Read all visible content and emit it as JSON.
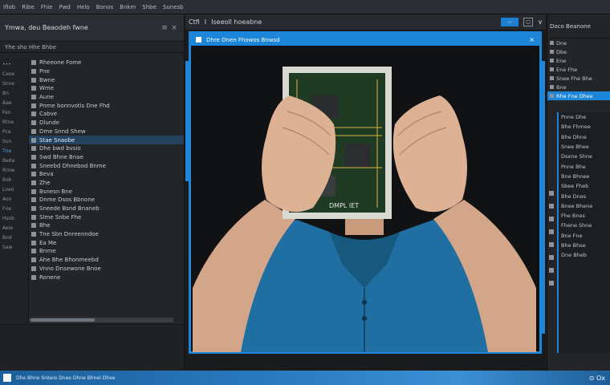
{
  "menubar": [
    "Ifiob",
    "Ribe",
    "Fhie",
    "Pwd",
    "Helo",
    "Bonos",
    "Bnkm",
    "Shbe",
    "Sunesb"
  ],
  "left_panel": {
    "title": "Ymwa, deu Beaodeh fwne",
    "subtitle": "Yhe sho Hhe Bhbe",
    "strip": [
      "•••",
      "Ceoe",
      "Snne",
      "Bn",
      "Aae",
      "Fen",
      "Rtne",
      "Pca",
      "Sun",
      "Tne",
      "Beda",
      "Rrnw",
      "Boh",
      "Lneo",
      "Aon",
      "Fne",
      "Hsob",
      "Aeie",
      "Bnd",
      "Saw"
    ],
    "rows": [
      "Rheeone Fome",
      "Pne",
      "Bwne",
      "Wme",
      "Aune",
      "Pnme bonnvotis Dne Fhd",
      "Cabve",
      "Dlunde",
      "Dme Snnd Shew",
      "Stae Snaobe",
      "Dhe bwd bvsio",
      "Swd Bhne Bnae",
      "Sneebd Dhnebod Bnme",
      "Beva",
      "Zhe",
      "Bsnesn Bne",
      "Dnme Dsos Bbnone",
      "Sneede Bsnd Bnaneb",
      "Slme Snbe Fhe",
      "Bhe",
      "Tne Sbn Dnreenndoe",
      "Ea Me",
      "Bnrne",
      "Ahe Bhe Bhonmeebd",
      "Vnno Dnsewone Bnoe",
      "Ronene"
    ],
    "selected_row": 9
  },
  "center": {
    "tabs": [
      "Ctfi",
      "I",
      "Iseeoll hoeabne"
    ],
    "viewer_title": "Dhre Dnen Fhowos Bnwsd"
  },
  "right_panel": {
    "title": "Doco Beanone",
    "rows": [
      "Dne",
      "Dbe",
      "Ene",
      "Ene Fhe",
      "Snee Fhe Bhe",
      "Bne"
    ],
    "selected": "Rhe Fne Dhee",
    "sub_rows": [
      "Pnne Dhe",
      "Bhe Fhmee",
      "Bhe Dhne",
      "Snee Bhee",
      "Dsene Shne",
      "Pnne Bhe",
      "Bne Bhnee",
      "Sbee Fheb",
      "Bhe Dnes",
      "Bnee Bhene",
      "Fhe Bnes",
      "Fhene Shne",
      "Bne Fne",
      "Bhe Bhse",
      "Dne Bheb"
    ]
  },
  "taskbar": {
    "label": "Dhe Bhne Snbeis Dnee Dhne Bhnel Dhee",
    "tray": "⊙ Ox"
  },
  "colors": {
    "accent": "#1d86d8",
    "panel": "#232528",
    "taskbar": "#2a7ac0"
  }
}
